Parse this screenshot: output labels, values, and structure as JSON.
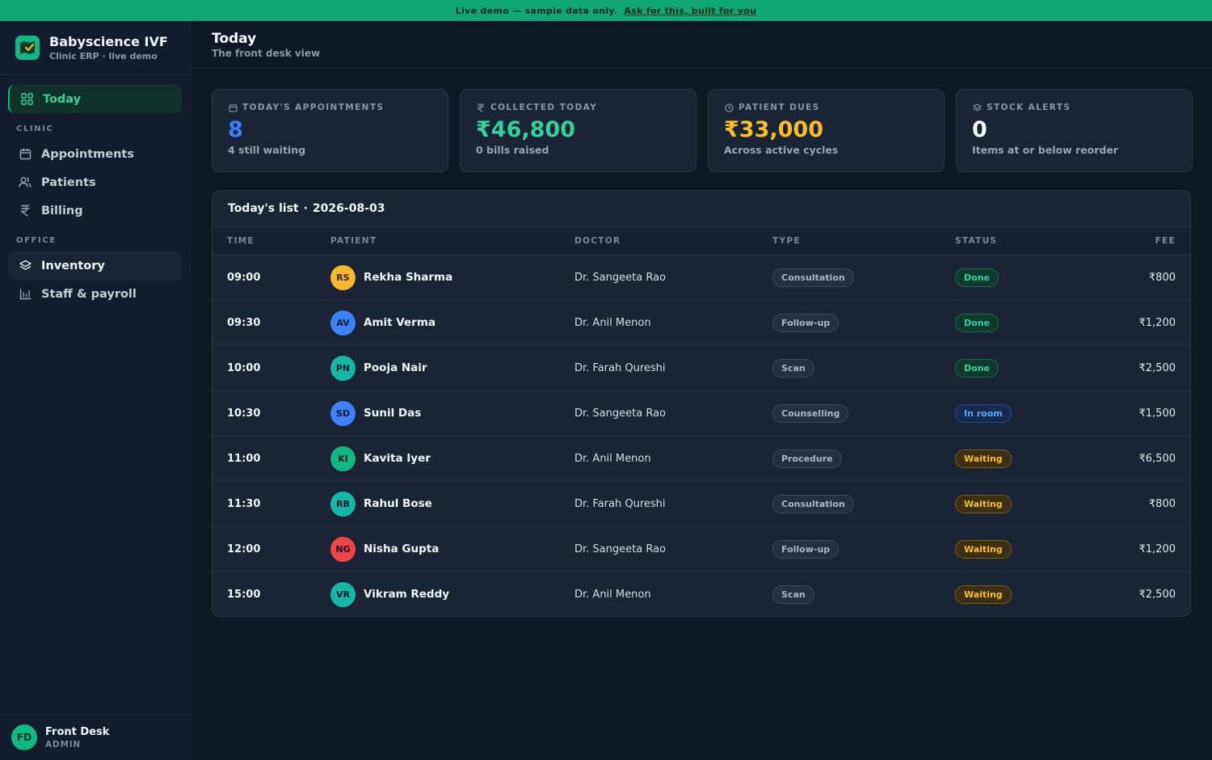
{
  "banner": {
    "text": "Live demo — sample data only.",
    "link": "Ask for this, built for you"
  },
  "brand": {
    "name": "Babyscience IVF",
    "subtitle": "Clinic ERP · live demo",
    "logo_icon": "map-check-icon"
  },
  "nav": {
    "today": "Today",
    "section_clinic": "CLINIC",
    "clinic_items": [
      {
        "label": "Appointments",
        "icon": "calendar-icon"
      },
      {
        "label": "Patients",
        "icon": "users-icon"
      },
      {
        "label": "Billing",
        "icon": "rupee-icon"
      }
    ],
    "section_office": "OFFICE",
    "office_items": [
      {
        "label": "Inventory",
        "icon": "layers-icon"
      },
      {
        "label": "Staff & payroll",
        "icon": "bar-chart-icon"
      }
    ]
  },
  "user": {
    "initials": "FD",
    "name": "Front Desk",
    "role": "ADMIN"
  },
  "page": {
    "title": "Today",
    "subtitle": "The front desk view"
  },
  "cards": [
    {
      "label": "TODAY'S APPOINTMENTS",
      "value": "8",
      "note": "4 still waiting",
      "color": "#3b82f6",
      "icon": "calendar-icon"
    },
    {
      "label": "COLLECTED TODAY",
      "value": "₹46,800",
      "note": "0 bills raised",
      "color": "#34d399",
      "icon": "rupee-icon"
    },
    {
      "label": "PATIENT DUES",
      "value": "₹33,000",
      "note": "Across active cycles",
      "color": "#fbbf24",
      "icon": "clock-icon"
    },
    {
      "label": "STOCK ALERTS",
      "value": "0",
      "note": "Items at or below reorder",
      "color": "#f9fafb",
      "icon": "layers-icon"
    }
  ],
  "list": {
    "title": "Today's list",
    "date": "2026-08-03",
    "columns": [
      "TIME",
      "PATIENT",
      "DOCTOR",
      "TYPE",
      "STATUS",
      "FEE"
    ],
    "rows": [
      {
        "time": "09:00",
        "initials": "RS",
        "avatar_color": "#f5b82e",
        "patient": "Rekha Sharma",
        "doctor": "Dr. Sangeeta Rao",
        "type": "Consultation",
        "status": "Done",
        "fee": "₹800"
      },
      {
        "time": "09:30",
        "initials": "AV",
        "avatar_color": "#3b82f6",
        "patient": "Amit Verma",
        "doctor": "Dr. Anil Menon",
        "type": "Follow-up",
        "status": "Done",
        "fee": "₹1,200"
      },
      {
        "time": "10:00",
        "initials": "PN",
        "avatar_color": "#14b8a6",
        "patient": "Pooja Nair",
        "doctor": "Dr. Farah Qureshi",
        "type": "Scan",
        "status": "Done",
        "fee": "₹2,500"
      },
      {
        "time": "10:30",
        "initials": "SD",
        "avatar_color": "#3b82f6",
        "patient": "Sunil Das",
        "doctor": "Dr. Sangeeta Rao",
        "type": "Counselling",
        "status": "In room",
        "fee": "₹1,500"
      },
      {
        "time": "11:00",
        "initials": "KI",
        "avatar_color": "#10b981",
        "patient": "Kavita Iyer",
        "doctor": "Dr. Anil Menon",
        "type": "Procedure",
        "status": "Waiting",
        "fee": "₹6,500"
      },
      {
        "time": "11:30",
        "initials": "RB",
        "avatar_color": "#14b8a6",
        "patient": "Rahul Bose",
        "doctor": "Dr. Farah Qureshi",
        "type": "Consultation",
        "status": "Waiting",
        "fee": "₹800"
      },
      {
        "time": "12:00",
        "initials": "NG",
        "avatar_color": "#ef4444",
        "patient": "Nisha Gupta",
        "doctor": "Dr. Sangeeta Rao",
        "type": "Follow-up",
        "status": "Waiting",
        "fee": "₹1,200"
      },
      {
        "time": "15:00",
        "initials": "VR",
        "avatar_color": "#14b8a6",
        "patient": "Vikram Reddy",
        "doctor": "Dr. Anil Menon",
        "type": "Scan",
        "status": "Waiting",
        "fee": "₹2,500"
      }
    ]
  }
}
